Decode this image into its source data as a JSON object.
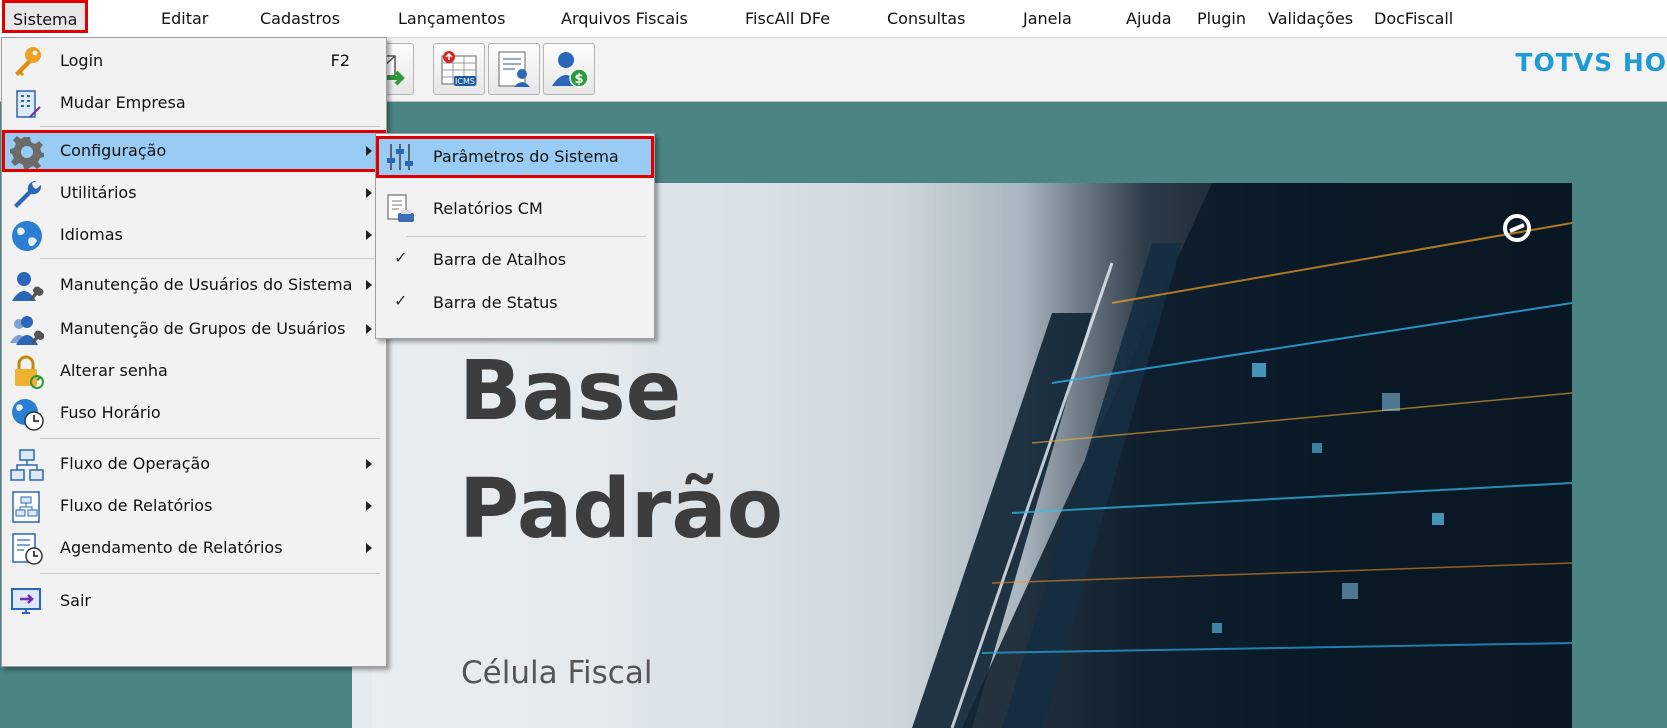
{
  "menubar": {
    "items": [
      {
        "label": "Sistema",
        "selected": true
      },
      {
        "label": "Editar"
      },
      {
        "label": "Cadastros"
      },
      {
        "label": "Lançamentos"
      },
      {
        "label": "Arquivos Fiscais"
      },
      {
        "label": "FiscAll DFe"
      },
      {
        "label": "Consultas"
      },
      {
        "label": "Janela"
      },
      {
        "label": "Ajuda"
      },
      {
        "label": "Plugin"
      },
      {
        "label": "Validações"
      },
      {
        "label": "DocFiscall"
      }
    ]
  },
  "toolbar": {
    "brand": "TOTVS HO",
    "buttons": [
      {
        "icon": "export-icon"
      },
      {
        "icon": "icms-table-icon",
        "badge": "ICMS"
      },
      {
        "icon": "user-document-icon"
      },
      {
        "icon": "user-money-icon",
        "badge": "$"
      }
    ]
  },
  "hero": {
    "title": "Base\nPadrão",
    "subtitle": "Célula Fiscal"
  },
  "sistema_menu": {
    "items": [
      {
        "label": "Login",
        "shortcut": "F2",
        "icon": "key-icon"
      },
      {
        "label": "Mudar Empresa",
        "icon": "building-icon"
      },
      {
        "label": "Configuração",
        "icon": "gear-icon",
        "submenu": true,
        "highlighted": true
      },
      {
        "label": "Utilitários",
        "icon": "wrench-icon",
        "submenu": true
      },
      {
        "label": "Idiomas",
        "icon": "globe-icon",
        "submenu": true
      },
      {
        "label": "Manutenção de Usuários do Sistema",
        "icon": "user-wrench-icon",
        "submenu": true
      },
      {
        "label": "Manutenção de Grupos de Usuários",
        "icon": "users-wrench-icon",
        "submenu": true
      },
      {
        "label": "Alterar senha",
        "icon": "lock-refresh-icon"
      },
      {
        "label": "Fuso Horário",
        "icon": "globe-clock-icon"
      },
      {
        "label": "Fluxo de Operação",
        "icon": "flowchart-icon",
        "submenu": true
      },
      {
        "label": "Fluxo de Relatórios",
        "icon": "report-flow-icon",
        "submenu": true
      },
      {
        "label": "Agendamento de Relatórios",
        "icon": "report-schedule-icon",
        "submenu": true
      },
      {
        "label": "Sair",
        "icon": "exit-icon"
      }
    ]
  },
  "configuracao_submenu": {
    "items": [
      {
        "label": "Parâmetros do Sistema",
        "icon": "sliders-icon",
        "highlighted": true
      },
      {
        "label": "Relatórios CM",
        "icon": "report-print-icon"
      },
      {
        "label": "Barra de Atalhos",
        "checked": true,
        "check": "✓"
      },
      {
        "label": "Barra de Status",
        "checked": true,
        "check": "✓"
      }
    ]
  },
  "colors": {
    "highlight": "#99ccf5",
    "annotation_border": "#e00000",
    "desktop": "#4a8584",
    "brand": "#1e9bd7"
  }
}
